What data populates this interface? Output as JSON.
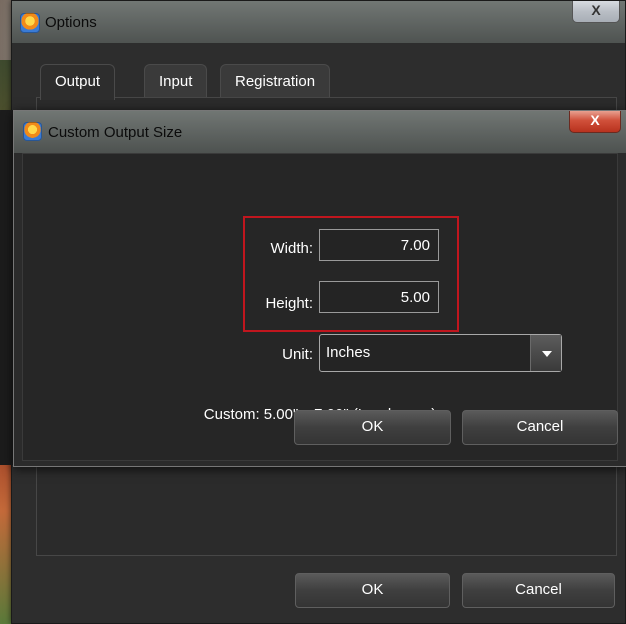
{
  "options_window": {
    "title": "Options",
    "close_label": "X",
    "tabs": [
      "Output",
      "Input",
      "Registration"
    ],
    "active_tab": "Output",
    "ok_label": "OK",
    "cancel_label": "Cancel"
  },
  "custom_dialog": {
    "title": "Custom Output Size",
    "close_label": "X",
    "width_label": "Width:",
    "width_value": "7.00",
    "height_label": "Height:",
    "height_value": "5.00",
    "unit_label": "Unit:",
    "unit_value": "Inches",
    "summary": "Custom: 5.00\" x 7.00\" (Landscape)",
    "ok_label": "OK",
    "cancel_label": "Cancel"
  },
  "colors": {
    "highlight": "#c0161e",
    "close_button_red": "#d0503a"
  }
}
